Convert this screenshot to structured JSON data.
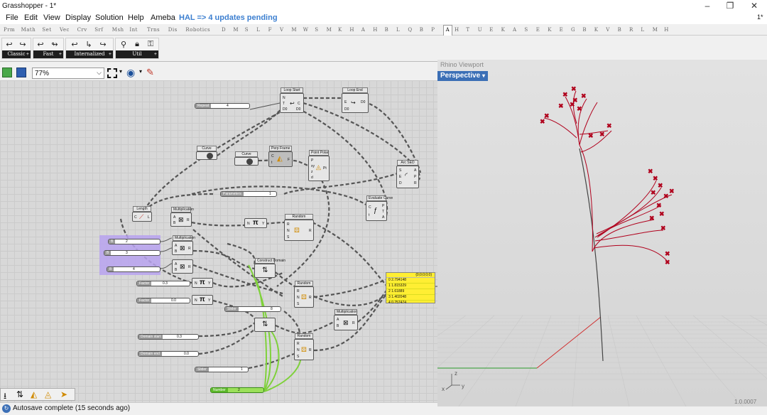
{
  "window": {
    "title": "Grasshopper - 1*",
    "badge": "1*"
  },
  "menu": [
    "File",
    "Edit",
    "View",
    "Display",
    "Solution",
    "Help",
    "Ameba"
  ],
  "hal_notice": "HAL => 4 updates pending",
  "tabs": [
    "Prm",
    "Math",
    "Set",
    "Vec",
    "Crv",
    "Srf",
    "Msh",
    "Int",
    "Trns",
    "Dis",
    "Robotics",
    "D",
    "M",
    "S",
    "L",
    "F",
    "V",
    "M",
    "W",
    "S",
    "M",
    "K",
    "H",
    "A",
    "H",
    "B",
    "L",
    "Q",
    "B",
    "P",
    "A",
    "H",
    "T",
    "U",
    "E",
    "K",
    "A",
    "S",
    "E",
    "K",
    "E",
    "G",
    "B",
    "K",
    "V",
    "B",
    "R",
    "L",
    "M",
    "H"
  ],
  "active_tab_index": 30,
  "ribbon_groups": [
    "Classic",
    "Fast",
    "Internalized",
    "Util"
  ],
  "zoom": "77%",
  "components": {
    "loop_start": {
      "title": "Loop Start",
      "inputs": [
        "N",
        "T",
        "D0"
      ],
      "outputs": [
        "C",
        "D0"
      ]
    },
    "loop_end": {
      "title": "Loop End",
      "inputs": [
        "E",
        "D0"
      ],
      "outputs": [
        "D0"
      ]
    },
    "curve1": {
      "title": "Curve"
    },
    "curve2": {
      "title": "Curve"
    },
    "perp_frame": {
      "title": "Perp Frame",
      "inputs": [
        "C",
        "t"
      ],
      "outputs": [
        "F"
      ]
    },
    "point_polar": {
      "title": "Point Polar",
      "inputs": [
        "P",
        "xy",
        "z",
        "d"
      ],
      "outputs": [
        "Pt"
      ]
    },
    "arc_sed": {
      "title": "Arc SED",
      "inputs": [
        "S",
        "E",
        "D"
      ],
      "outputs": [
        "A",
        "P",
        "R"
      ]
    },
    "evaluate_curve": {
      "title": "Evaluate Curve",
      "inputs": [
        "C",
        "t"
      ],
      "outputs": [
        "P",
        "T",
        "A"
      ]
    },
    "length": {
      "title": "Length",
      "inputs": [
        "C"
      ],
      "outputs": [
        "L"
      ]
    },
    "multiplication": {
      "title": "Multiplication",
      "inputs": [
        "A",
        "B"
      ],
      "outputs": [
        "R"
      ]
    },
    "random": {
      "title": "Random",
      "inputs": [
        "R",
        "N",
        "S"
      ],
      "outputs": [
        "R"
      ]
    },
    "construct_domain": {
      "title": "Construct Domain"
    },
    "pi": {
      "inputs": [
        "N"
      ],
      "outputs": [
        "Y"
      ]
    }
  },
  "sliders": {
    "repeat": {
      "label": "Repeat",
      "value": "4"
    },
    "parameters": {
      "label": "Parameters",
      "value": "1"
    },
    "s1": {
      "label": "B",
      "value": "2"
    },
    "s2": {
      "label": "B",
      "value": "3"
    },
    "s3": {
      "label": "B",
      "value": "4"
    },
    "factor1": {
      "label": "Factor",
      "value": "0.3"
    },
    "factor2": {
      "label": "Factor",
      "value": "0.0"
    },
    "slider": {
      "label": "Slider",
      "value": "8"
    },
    "domain_start": {
      "label": "Domain start",
      "value": "0.3"
    },
    "domain_end": {
      "label": "Domain end",
      "value": "0.0"
    },
    "slider2": {
      "label": "Slider",
      "value": "1"
    },
    "number": {
      "label": "Number",
      "value": "2"
    }
  },
  "panel": {
    "header": "{0;0;0;0;0}",
    "rows": [
      "0 2.794148",
      "1 1.815329",
      "2 1.61889",
      "3 1.402048",
      "4 0.757474"
    ]
  },
  "viewport": {
    "window_title": "Rhino Viewport",
    "tab": "Perspective",
    "axis_x": "x",
    "axis_y": "y",
    "axis_z": "z",
    "corner_text": "1.0.0007"
  },
  "status": "Autosave complete (15 seconds ago)",
  "colors": {
    "branch": "#b0001c",
    "panel": "#ffee33",
    "group": "#b9a3f0",
    "wire_number": "#7fd13b",
    "accent": "#3b6fb6"
  }
}
